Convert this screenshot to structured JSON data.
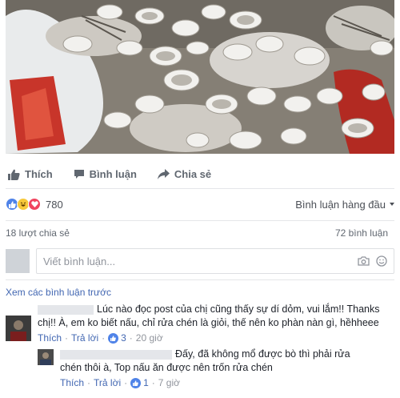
{
  "post": {
    "actions": {
      "like": "Thích",
      "comment": "Bình luận",
      "share": "Chia sẻ"
    },
    "reactions": {
      "count": "780",
      "icons": [
        "like-icon",
        "haha-icon",
        "love-icon"
      ]
    },
    "sort_label": "Bình luận hàng đầu",
    "shares": "18 lượt chia sẻ",
    "comments_count": "72 bình luận"
  },
  "composer": {
    "placeholder": "Viết bình luận..."
  },
  "view_previous": "Xem các bình luận trước",
  "comments": [
    {
      "text_line1": "Lúc nào đọc post của chị cũng thấy sự dí dỏm, vui lắm!! Thanks",
      "text_line2": "chị!! À, em ko biết nấu, chỉ rửa chén là giỏi, thế nên ko phàn nàn gì, hềhheee",
      "like": "Thích",
      "reply": "Trả lời",
      "likes": "3",
      "time": "20 giờ"
    },
    {
      "text_line1": "Đấy, đã không mổ được bò thì phải rửa",
      "text_line2": "chén thôi à, Top nấu ăn được nên trốn rửa chén",
      "like": "Thích",
      "reply": "Trả lời",
      "likes": "1",
      "time": "7 giờ"
    }
  ],
  "colors": {
    "link": "#4267b2",
    "like_blue": "#4f83e8",
    "love_red": "#f0445f",
    "haha_yellow": "#f7c83a",
    "muted": "#606770"
  }
}
